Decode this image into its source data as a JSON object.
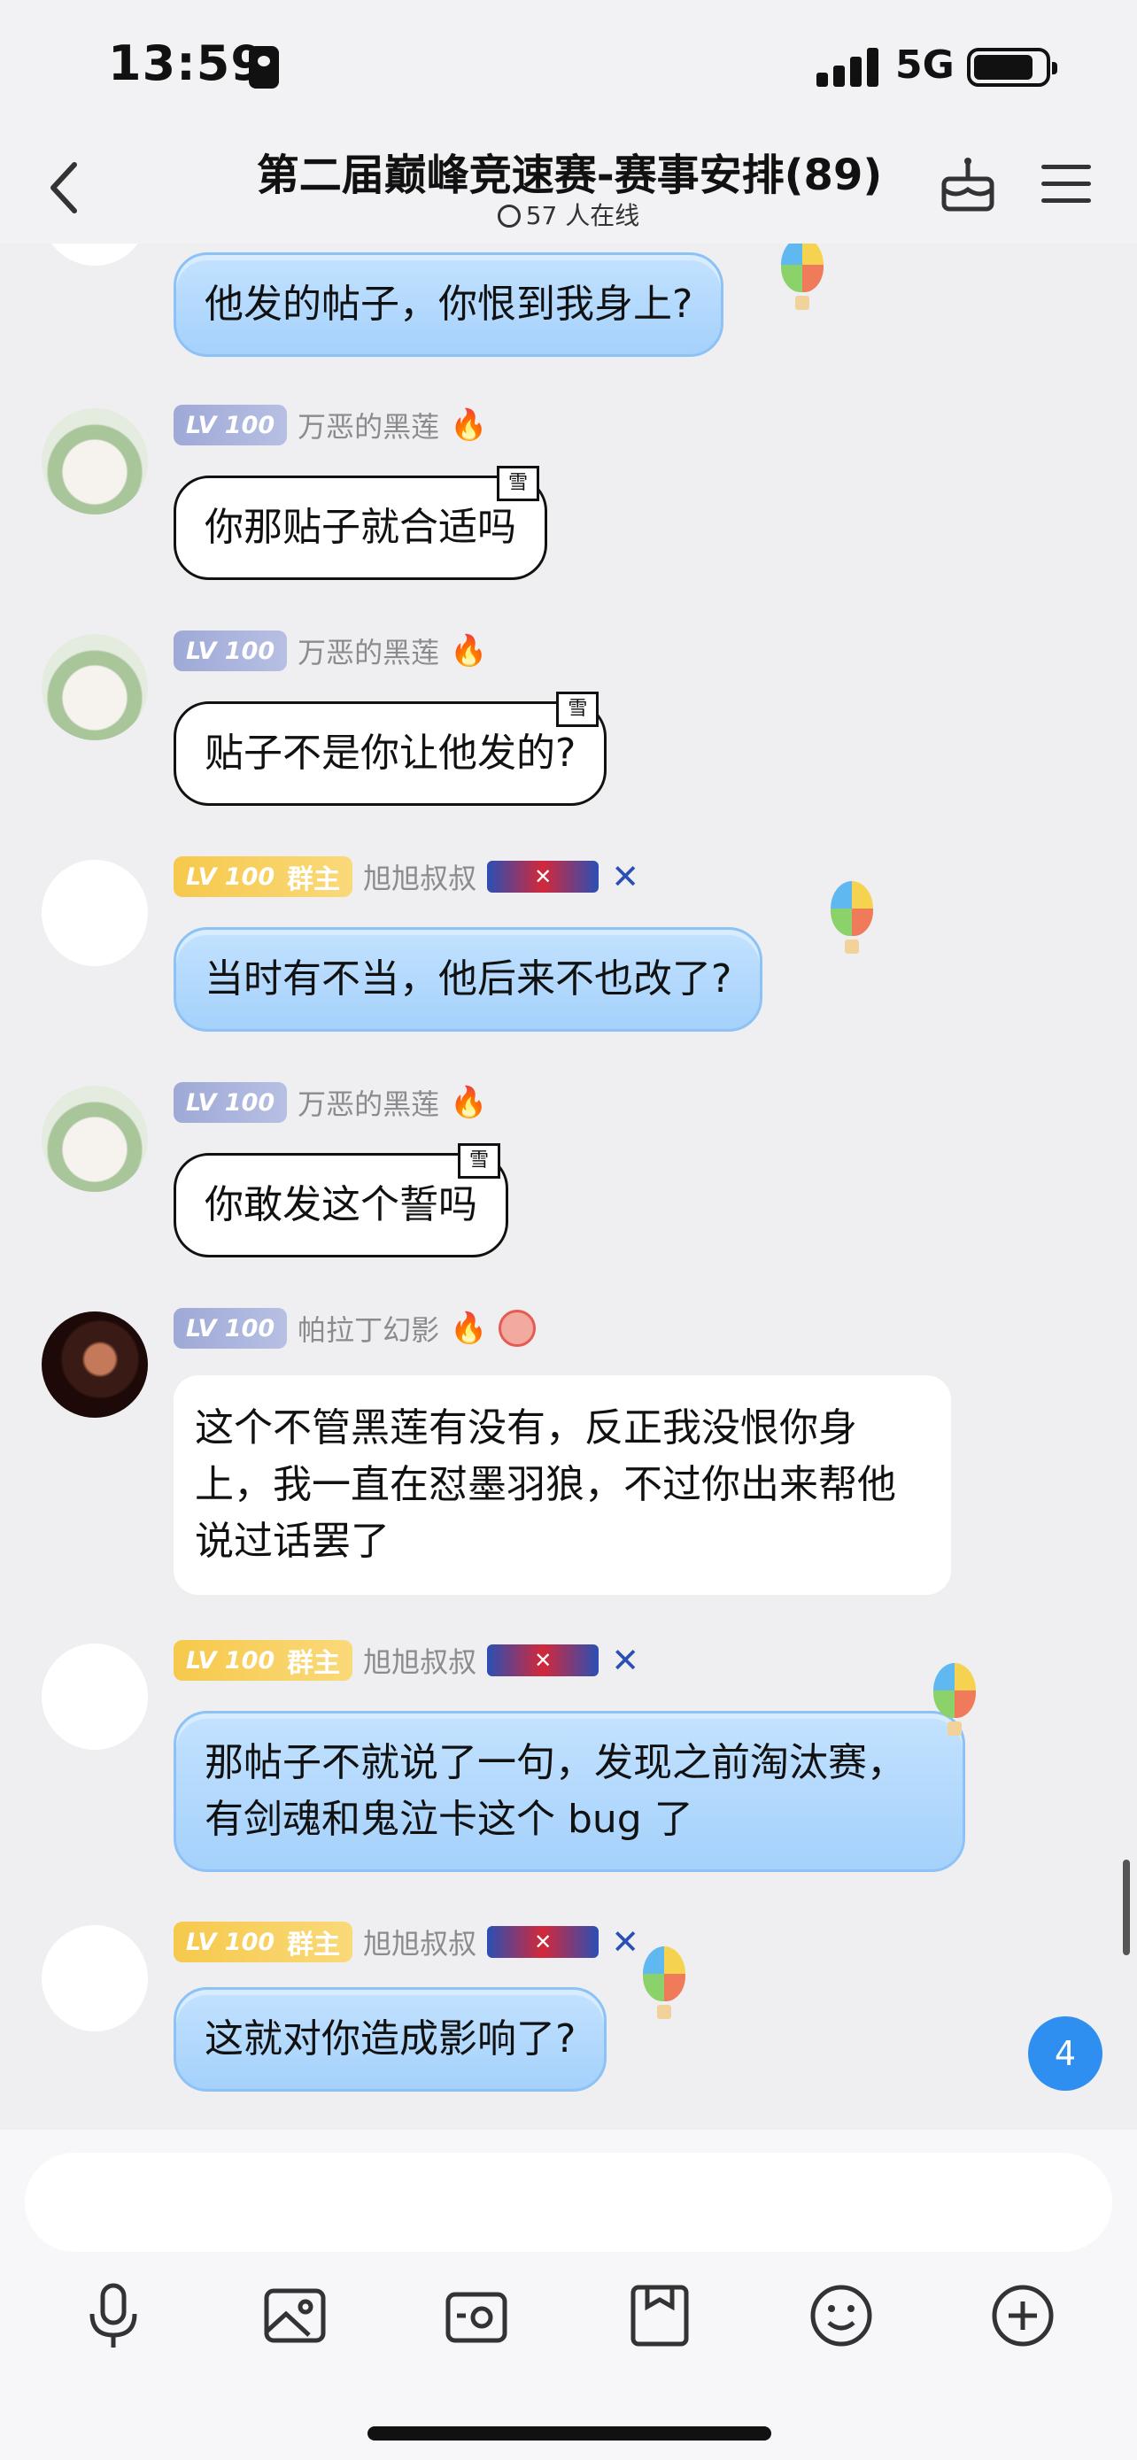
{
  "status": {
    "time": "13:59",
    "network": "5G"
  },
  "header": {
    "title": "第二届巅峰竞速赛-赛事安排(89)",
    "online": "57 人在线"
  },
  "messages": [
    {
      "type": "blue",
      "name": "",
      "text": "他发的帖子，你恨到我身上?"
    },
    {
      "type": "frame",
      "level": "LV 100",
      "name": "万恶的黑莲",
      "tag": "雪",
      "text": "你那贴子就合适吗"
    },
    {
      "type": "frame",
      "level": "LV 100",
      "name": "万恶的黑莲",
      "tag": "雪",
      "text": "贴子不是你让他发的?"
    },
    {
      "type": "blue",
      "level": "LV 100",
      "role": "群主",
      "name": "旭旭叔叔",
      "text": "当时有不当，他后来不也改了?"
    },
    {
      "type": "frame",
      "level": "LV 100",
      "name": "万恶的黑莲",
      "tag": "雪",
      "text": "你敢发这个誓吗"
    },
    {
      "type": "white",
      "level": "LV 100",
      "name": "帕拉丁幻影",
      "text": "这个不管黑莲有没有，反正我没恨你身上，我一直在怼墨羽狼，不过你出来帮他说过话罢了"
    },
    {
      "type": "blue",
      "level": "LV 100",
      "role": "群主",
      "name": "旭旭叔叔",
      "text": "那帖子不就说了一句，发现之前淘汰赛，有剑魂和鬼泣卡这个 bug 了"
    },
    {
      "type": "blue",
      "level": "LV 100",
      "role": "群主",
      "name": "旭旭叔叔",
      "text": "这就对你造成影响了?"
    }
  ],
  "unread_count": "4",
  "input": {
    "value": ""
  },
  "icons": [
    "mic-icon",
    "image-icon",
    "camera-icon",
    "file-icon",
    "emoji-icon",
    "plus-icon"
  ]
}
